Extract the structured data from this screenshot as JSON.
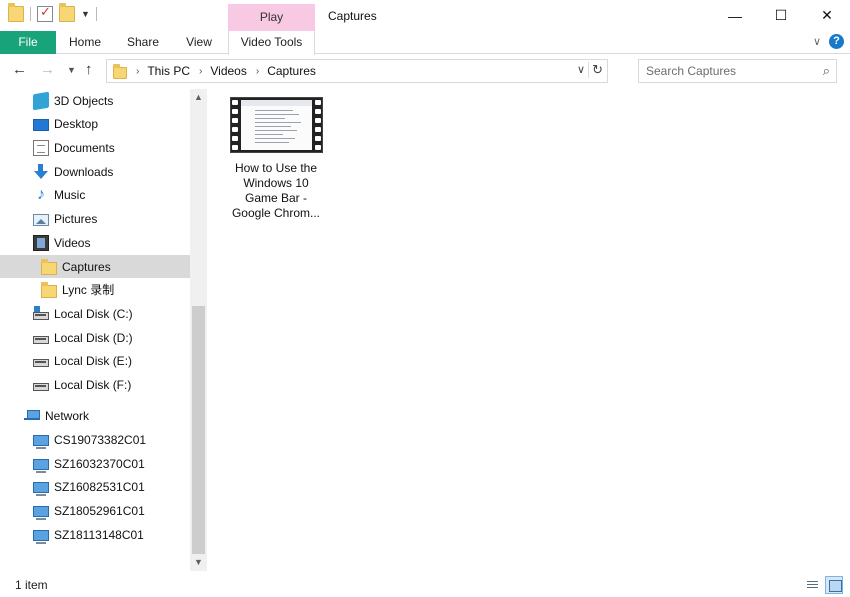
{
  "titlebar": {
    "contextual_tab": "Play",
    "window_title": "Captures",
    "minimize": "—",
    "maximize": "☐",
    "close": "✕"
  },
  "ribbon": {
    "tabs": [
      {
        "label": "File"
      },
      {
        "label": "Home"
      },
      {
        "label": "Share"
      },
      {
        "label": "View"
      },
      {
        "label": "Video Tools"
      }
    ],
    "collapse_glyph": "∨",
    "help_glyph": "?"
  },
  "address": {
    "crumbs": [
      "This PC",
      "Videos",
      "Captures"
    ]
  },
  "search": {
    "placeholder": "Search Captures"
  },
  "navpane": {
    "items": [
      {
        "label": "3D Objects",
        "icon": "3d-objects-icon"
      },
      {
        "label": "Desktop",
        "icon": "desktop-icon"
      },
      {
        "label": "Documents",
        "icon": "documents-icon"
      },
      {
        "label": "Downloads",
        "icon": "downloads-icon"
      },
      {
        "label": "Music",
        "icon": "music-icon"
      },
      {
        "label": "Pictures",
        "icon": "pictures-icon"
      },
      {
        "label": "Videos",
        "icon": "videos-icon"
      },
      {
        "label": "Captures",
        "icon": "folder-icon",
        "selected": true
      },
      {
        "label": "Lync 录制",
        "icon": "folder-icon"
      },
      {
        "label": "Local Disk (C:)",
        "icon": "disk-icon"
      },
      {
        "label": "Local Disk (D:)",
        "icon": "disk-icon"
      },
      {
        "label": "Local Disk (E:)",
        "icon": "disk-icon"
      },
      {
        "label": "Local Disk (F:)",
        "icon": "disk-icon"
      },
      {
        "label": "Network",
        "icon": "network-icon"
      },
      {
        "label": "CS19073382C01",
        "icon": "computer-icon"
      },
      {
        "label": "SZ16032370C01",
        "icon": "computer-icon"
      },
      {
        "label": "SZ16082531C01",
        "icon": "computer-icon"
      },
      {
        "label": "SZ18052961C01",
        "icon": "computer-icon"
      },
      {
        "label": "SZ18113148C01",
        "icon": "computer-icon"
      }
    ]
  },
  "content": {
    "files": [
      {
        "name": "How to Use the Windows 10 Game Bar - Google Chrom...",
        "icon": "video-file-icon"
      }
    ]
  },
  "status": {
    "item_count": "1 item"
  }
}
